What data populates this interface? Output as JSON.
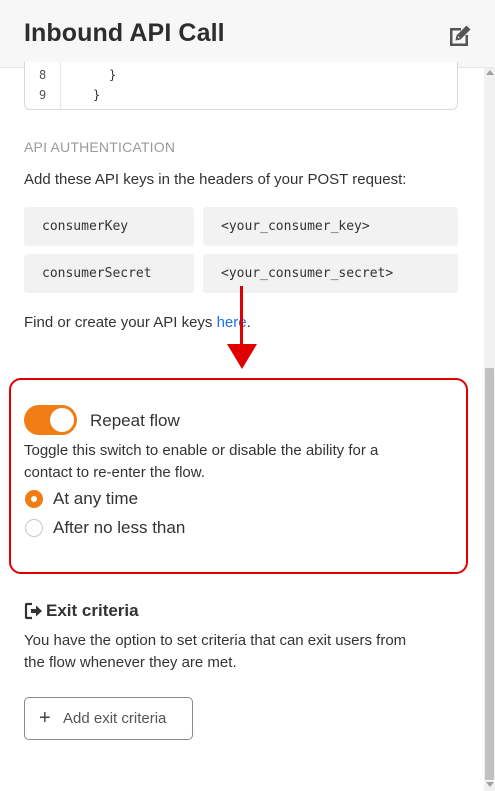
{
  "header": {
    "title": "Inbound API Call"
  },
  "code": {
    "lines": [
      {
        "num": "8",
        "text": "}"
      },
      {
        "num": "9",
        "text": "}"
      }
    ]
  },
  "auth": {
    "section_title": "API AUTHENTICATION",
    "description": "Add these API keys in the headers of your POST request:",
    "rows": [
      {
        "key": "consumerKey",
        "value": "<your_consumer_key>"
      },
      {
        "key": "consumerSecret",
        "value": "<your_consumer_secret>"
      }
    ],
    "find_text": "Find or create your API keys ",
    "link_text": "here",
    "find_suffix": "."
  },
  "repeat": {
    "toggle_label": "Repeat flow",
    "toggle_on": true,
    "description_line1": "Toggle this switch to enable or disable the ability for a",
    "description_line2": "contact to re-enter the flow.",
    "options": [
      {
        "label": "At any time",
        "selected": true
      },
      {
        "label": "After no less than",
        "selected": false
      }
    ]
  },
  "exit": {
    "title": "Exit criteria",
    "description_line1": "You have the option to set criteria that can exit users from",
    "description_line2": "the flow whenever they are met.",
    "button_label": "Add exit criteria"
  },
  "colors": {
    "accent": "#f07d13",
    "annotation": "#e00000",
    "link": "#1a73e8"
  },
  "icons": {
    "edit": "edit-icon",
    "exit": "sign-out-icon",
    "plus": "plus-icon"
  }
}
